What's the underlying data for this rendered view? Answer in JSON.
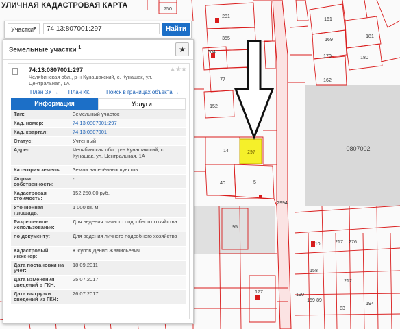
{
  "map": {
    "title": "УЛИЧНАЯ КАДАСТРОВАЯ КАРТА",
    "labels": {
      "l750": "750",
      "l281": "281",
      "l161": "161",
      "l355": "355",
      "l169": "169",
      "l181": "181",
      "l504": "504",
      "l170": "170",
      "l180": "180",
      "l77": "77",
      "l162": "162",
      "l152": "152",
      "l14": "14",
      "l297": "297",
      "l0807002": "0807002",
      "l40": "40",
      "l5": "5",
      "l2994": "2994",
      "l95": "95",
      "l110": "110",
      "l217": "217",
      "l276": "276",
      "l158": "158",
      "l212": "212",
      "l177": "177",
      "l190": "190",
      "l159": "159",
      "l89": "89",
      "l83": "83",
      "l194": "194",
      "l257": "257",
      "l594": "594"
    },
    "colors": {
      "selected_parcel": "#f5f02a",
      "parcel_line": "#d91c1c",
      "road_fill": "#fbe3e3",
      "block": "#d9d9d9",
      "arrow": "#111111"
    }
  },
  "search": {
    "mode": "Участки",
    "query": "74:13:807001:297",
    "button": "Найти"
  },
  "panel": {
    "title": "Земельные участки",
    "title_sup": "1",
    "star_icon": "star-icon",
    "object": {
      "number": "74:13:0807001:297",
      "address": "Челябинская обл., р-н Кунашакский, с. Кунашак, ул. Центральная, 1А",
      "links": [
        "План ЗУ →",
        "План КК →",
        "Поиск в границах объекта →"
      ]
    },
    "tabs": [
      "Информация",
      "Услуги"
    ],
    "rows": [
      {
        "k": "Тип:",
        "v": "Земельный участок"
      },
      {
        "k": "Кад. номер:",
        "v": "74:13:0807001:297"
      },
      {
        "k": "Кад. квартал:",
        "v": "74:13:0807001"
      },
      {
        "k": "Статус:",
        "v": "Учтенный"
      },
      {
        "k": "Адрес:",
        "v": "Челябинская обл., р-н Кунашакский, с. Кунашак, ул. Центральная, 1А"
      },
      {
        "k": "Категория земель:",
        "v": "Земли населённых пунктов"
      },
      {
        "k": "Форма собственности:",
        "v": "-"
      },
      {
        "k": "Кадастровая стоимость:",
        "v": "152 250,00 руб."
      },
      {
        "k": "Уточненная площадь:",
        "v": "1 000 кв. м"
      },
      {
        "k": "Разрешенное использование:",
        "v": "Для ведения личного подсобного хозяйства"
      },
      {
        "k": "по документу:",
        "v": "Для ведения личного подсобного хозяйства"
      },
      {
        "k": "Кадастровый инженер:",
        "v": "Юсупов Денис Жамильевич"
      },
      {
        "k": "Дата постановки на учет:",
        "v": "18.09.2011"
      },
      {
        "k": "Дата изменения сведений в ГКН:",
        "v": "25.07.2017"
      },
      {
        "k": "Дата выгрузки сведений из ГКН:",
        "v": "26.07.2017"
      }
    ]
  }
}
